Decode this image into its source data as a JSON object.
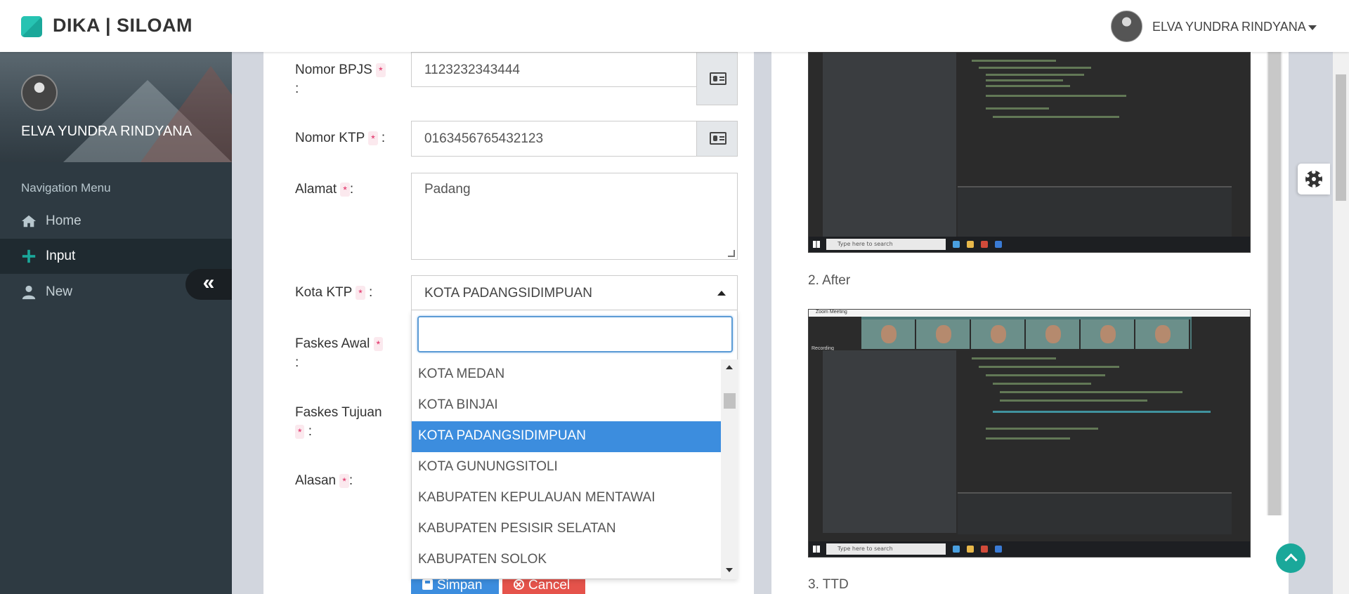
{
  "app": {
    "brand": "DIKA | SILOAM",
    "user_name": "ELVA YUNDRA RINDYANA"
  },
  "colors": {
    "accent": "#1aa89a",
    "primary": "#3c8dde",
    "danger": "#e5534b",
    "sidebar_bg": "#2e3a42"
  },
  "sidebar": {
    "user_name": "ELVA YUNDRA RINDYANA",
    "nav_header": "Navigation Menu",
    "items": [
      {
        "label": "Home",
        "icon": "home-icon"
      },
      {
        "label": "Input",
        "icon": "plus-icon",
        "active": true
      },
      {
        "label": "New",
        "icon": "user-icon"
      }
    ],
    "collapse_label": "«"
  },
  "form": {
    "required_mark": "*",
    "bpjs": {
      "label": "Nomor BPJS",
      "value": "1123232343444"
    },
    "ktp": {
      "label": "Nomor KTP",
      "value": "0163456765432123"
    },
    "alamat": {
      "label": "Alamat",
      "value": "Padang"
    },
    "kota_ktp": {
      "label": "Kota KTP",
      "selected": "KOTA PADANGSIDIMPUAN"
    },
    "faskes_awal": {
      "label": "Faskes Awal"
    },
    "faskes_tujuan": {
      "label": "Faskes Tujuan"
    },
    "alasan": {
      "label": "Alasan"
    },
    "colon": ":",
    "save_label": "Simpan",
    "cancel_label": "Cancel"
  },
  "dropdown": {
    "search_value": "",
    "options": [
      "KOTA MEDAN",
      "KOTA BINJAI",
      "KOTA PADANGSIDIMPUAN",
      "KOTA GUNUNGSITOLI",
      "KABUPATEN KEPULAUAN MENTAWAI",
      "KABUPATEN PESISIR SELATAN",
      "KABUPATEN SOLOK"
    ],
    "selected_index": 2
  },
  "right_panel": {
    "after_label": "2. After",
    "ttd_label": "3. TTD",
    "taskbar_search": "Type here to search",
    "zoom_title": "Zoom Meeting",
    "recording": "Recording"
  }
}
